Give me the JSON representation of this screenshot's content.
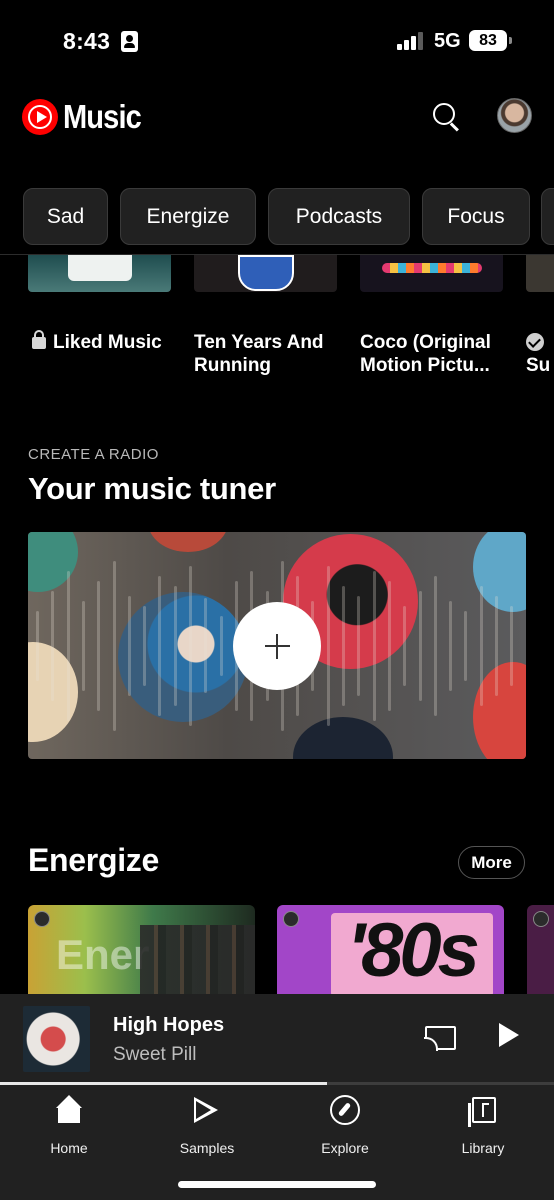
{
  "status_bar": {
    "time": "8:43",
    "network": "5G",
    "battery": "83"
  },
  "header": {
    "app_name": "Music",
    "search_icon": "search-icon",
    "avatar_icon": "avatar"
  },
  "chips": [
    "Sad",
    "Energize",
    "Podcasts",
    "Focus"
  ],
  "shelf": {
    "items": [
      {
        "label": "Liked Music",
        "icon": "lock-icon"
      },
      {
        "label_line1": "Ten Years And",
        "label_line2": "Running"
      },
      {
        "label_line1": "Coco (Original",
        "label_line2": "Motion Pictu..."
      },
      {
        "label_partial": "Su",
        "icon": "check-icon"
      }
    ]
  },
  "radio": {
    "kicker": "CREATE A RADIO",
    "title": "Your music tuner",
    "action_icon": "plus-icon"
  },
  "energize": {
    "title": "Energize",
    "more_label": "More",
    "cards": [
      {
        "art_text": "Ener"
      },
      {
        "art_text": "'80s"
      }
    ]
  },
  "mini_player": {
    "track": "High Hopes",
    "artist": "Sweet Pill",
    "progress": 0.59
  },
  "bottom_nav": {
    "items": [
      {
        "label": "Home",
        "icon": "home-icon"
      },
      {
        "label": "Samples",
        "icon": "samples-icon"
      },
      {
        "label": "Explore",
        "icon": "explore-icon"
      },
      {
        "label": "Library",
        "icon": "library-icon"
      }
    ]
  },
  "colors": {
    "accent": "#ff0000",
    "background": "#000000",
    "surface": "#212121"
  }
}
